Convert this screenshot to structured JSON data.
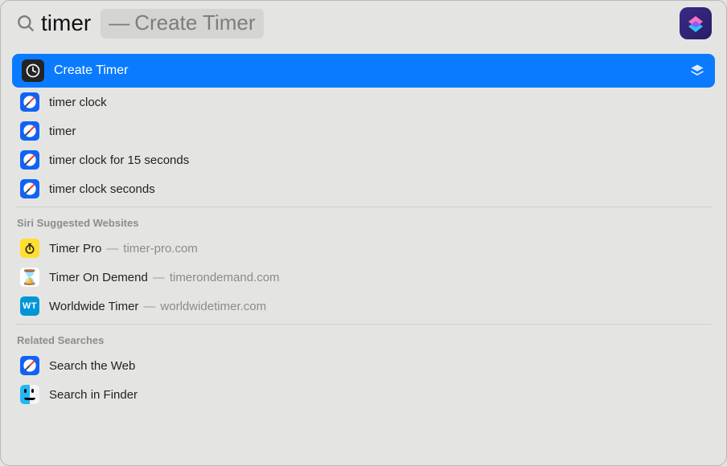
{
  "search": {
    "query": "timer",
    "top_hit_suggestion": "Create Timer"
  },
  "sections": [
    {
      "kind": "top",
      "items": [
        {
          "icon": "clock-black",
          "label": "Create Timer",
          "selected": true,
          "trailing": "layers"
        },
        {
          "icon": "safari",
          "label": "timer clock"
        },
        {
          "icon": "safari",
          "label": "timer"
        },
        {
          "icon": "safari",
          "label": "timer clock for 15 seconds"
        },
        {
          "icon": "safari",
          "label": "timer clock seconds"
        }
      ]
    },
    {
      "kind": "group",
      "header": "Siri Suggested Websites",
      "items": [
        {
          "icon": "stopwatch",
          "label": "Timer Pro",
          "secondary": "timer-pro.com"
        },
        {
          "icon": "hourglass",
          "label": "Timer On Demend",
          "secondary": "timerondemand.com"
        },
        {
          "icon": "wt",
          "label": "Worldwide Timer",
          "secondary": "worldwidetimer.com"
        }
      ]
    },
    {
      "kind": "group",
      "header": "Related Searches",
      "items": [
        {
          "icon": "safari",
          "label": "Search the Web"
        },
        {
          "icon": "finder",
          "label": "Search in Finder"
        }
      ]
    }
  ]
}
